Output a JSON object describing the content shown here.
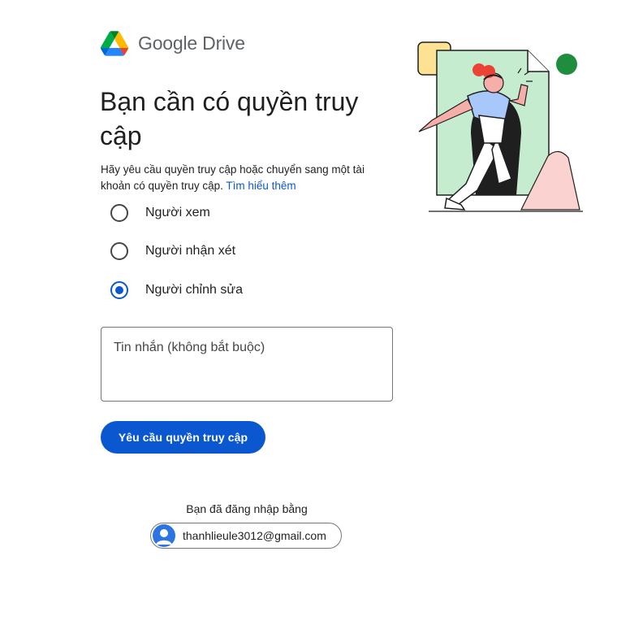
{
  "header": {
    "product_name": "Google Drive",
    "logo_icon": "google-drive-logo"
  },
  "main": {
    "title": "Bạn cần có quyền truy cập",
    "description": "Hãy yêu cầu quyền truy cập hoặc chuyển sang một tài khoản có quyền truy cập.",
    "learn_more_link": "Tìm hiểu thêm",
    "roles": [
      {
        "label": "Người xem",
        "selected": false
      },
      {
        "label": "Người nhận xét",
        "selected": false
      },
      {
        "label": "Người chỉnh sửa",
        "selected": true
      }
    ],
    "message": {
      "value": "",
      "placeholder": "Tin nhắn (không bắt buộc)"
    },
    "request_button_label": "Yêu cầu quyền truy cập"
  },
  "account": {
    "signed_in_label": "Bạn đã đăng nhập bằng",
    "email": "thanhlieule3012@gmail.com",
    "avatar_icon": "person-icon"
  },
  "colors": {
    "accent": "#0b57d0",
    "text": "#1f1f1f",
    "muted": "#5f6368"
  },
  "illustration": {
    "name": "person-entering-document-illustration"
  }
}
